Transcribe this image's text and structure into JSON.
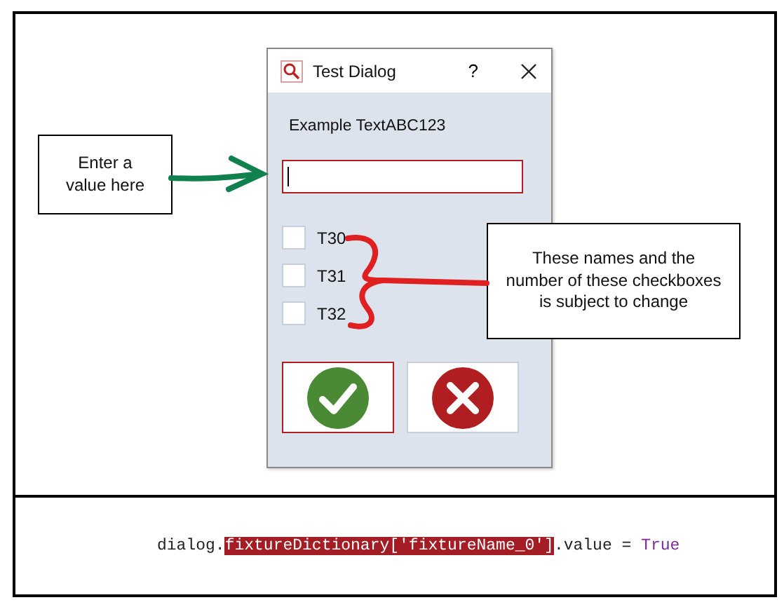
{
  "dialog": {
    "title": "Test Dialog",
    "help": "?",
    "label": "Example TextABC123",
    "input": {
      "focused": true
    },
    "checkboxes": [
      {
        "label": "T30",
        "checked": false
      },
      {
        "label": "T31",
        "checked": false
      },
      {
        "label": "T32",
        "checked": false
      }
    ],
    "buttons": [
      {
        "kind": "ok",
        "focused": true
      },
      {
        "kind": "cancel",
        "focused": false
      }
    ]
  },
  "annotations": [
    {
      "kind": "input",
      "text": "Enter a value here"
    },
    {
      "kind": "checkboxes",
      "text": "These names and the number of these checkboxes is subject to change"
    }
  ],
  "code": [
    {
      "kind": "plain",
      "text": "dialog."
    },
    {
      "kind": "highlight",
      "text": "fixtureDictionary['fixtureName_0']"
    },
    {
      "kind": "plain",
      "text": ".value = "
    },
    {
      "kind": "keyword",
      "text": "True"
    }
  ]
}
